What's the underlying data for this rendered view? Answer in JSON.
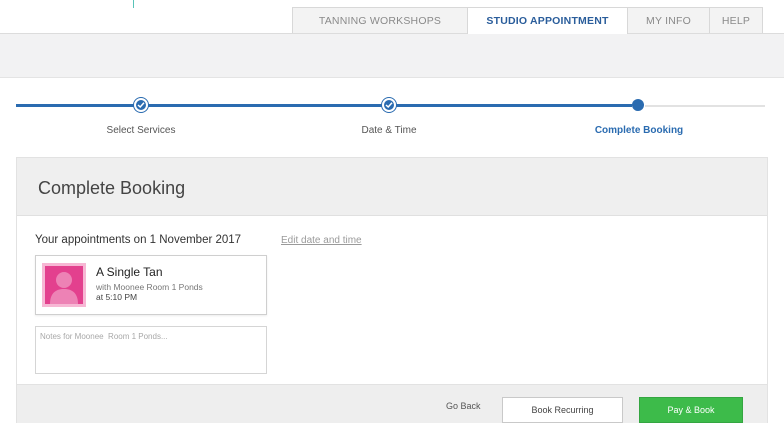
{
  "nav": {
    "tabs": [
      {
        "label": "TANNING WORKSHOPS",
        "active": false
      },
      {
        "label": "STUDIO APPOINTMENT",
        "active": true
      },
      {
        "label": "MY INFO",
        "active": false
      },
      {
        "label": "HELP",
        "active": false
      }
    ]
  },
  "progress": {
    "steps": [
      {
        "label": "Select Services",
        "state": "done"
      },
      {
        "label": "Date & Time",
        "state": "done"
      },
      {
        "label": "Complete Booking",
        "state": "current"
      }
    ],
    "colors": {
      "active": "#2a6bb0",
      "inactive": "#e2e2e2"
    }
  },
  "booking": {
    "title": "Complete Booking",
    "appointments_heading": "Your appointments on 1 November 2017",
    "edit_link": "Edit date and time",
    "service": {
      "name": "A Single Tan",
      "with": "with Moonee Room 1 Ponds",
      "time": "at 5:10 PM",
      "avatar_icon": "person-silhouette-icon",
      "avatar_color": "#e3408e"
    },
    "notes_placeholder": "Notes for Moonee  Room 1 Ponds..."
  },
  "footer": {
    "go_back": "Go Back",
    "book_recurring": "Book Recurring",
    "pay_book": "Pay & Book",
    "pay_color": "#3dbb4a"
  }
}
